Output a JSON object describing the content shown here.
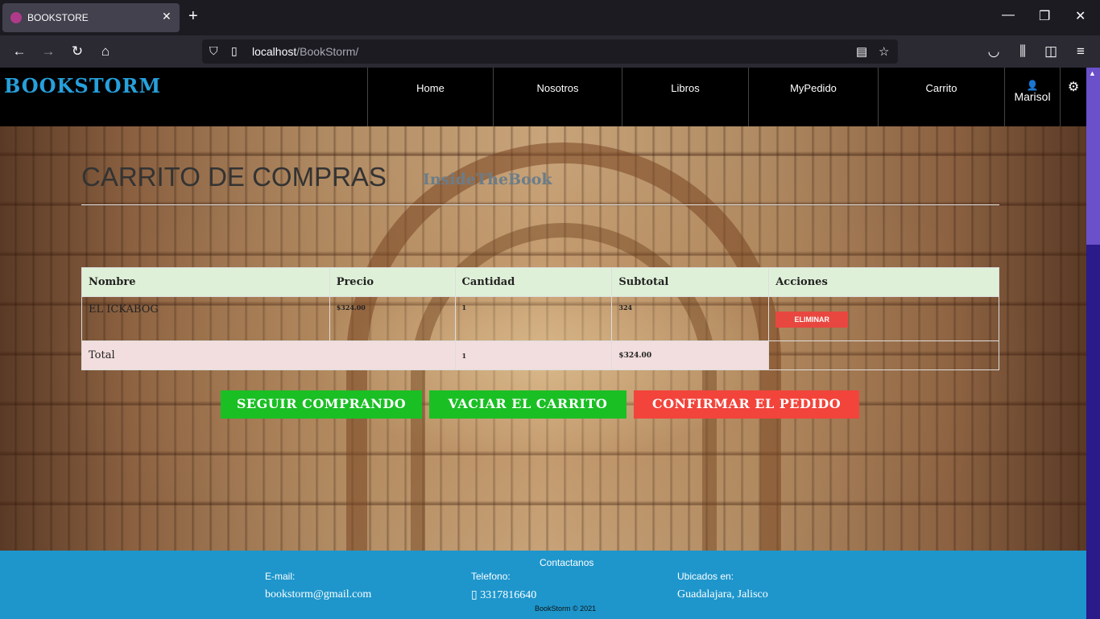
{
  "browser": {
    "tab_title": "BOOKSTORE",
    "tab_close": "✕",
    "new_tab": "+",
    "url_host": "localhost",
    "url_path": "/BookStorm/",
    "window_controls": {
      "minimize": "—",
      "restore": "❐",
      "close": "✕"
    },
    "nav_icons": [
      "back-icon",
      "forward-icon",
      "reload-icon",
      "home-icon"
    ]
  },
  "site": {
    "brand": "BOOKSTORM",
    "menu": [
      "Home",
      "Nosotros",
      "Libros",
      "MyPedido",
      "Carrito"
    ],
    "user_name": "Marisol"
  },
  "cart": {
    "title": "CARRITO DE COMPRAS",
    "subtitle": "InsideTheBook",
    "headers": [
      "Nombre",
      "Precio",
      "Cantidad",
      "Subtotal",
      "Acciones"
    ],
    "rows": [
      {
        "nombre": "EL ICKABOG",
        "precio": "$324.00",
        "cantidad": "1",
        "subtotal": "324",
        "accion": "ELIMINAR"
      }
    ],
    "total": {
      "label": "Total",
      "cantidad": "1",
      "subtotal": "$324.00"
    },
    "buttons": {
      "seguir": "SEGUIR COMPRANDO",
      "vaciar": "VACIAR EL CARRITO",
      "confirmar": "CONFIRMAR EL PEDIDO"
    }
  },
  "footer": {
    "title": "Contactanos",
    "email_label": "E-mail:",
    "email": "bookstorm@gmail.com",
    "phone_label": "Telefono:",
    "phone": "3317816640",
    "location_label": "Ubicados en:",
    "location": "Guadalajara, Jalisco",
    "copyright": "BookStorm © 2021"
  },
  "colors": {
    "brand": "#27a0dc",
    "header_bg": "#000000",
    "footer_bg": "#1e96cc",
    "table_head_bg": "#dff0d8",
    "total_row_bg": "#f2dede",
    "button_green": "#1abf24",
    "button_red": "#f2443b"
  }
}
